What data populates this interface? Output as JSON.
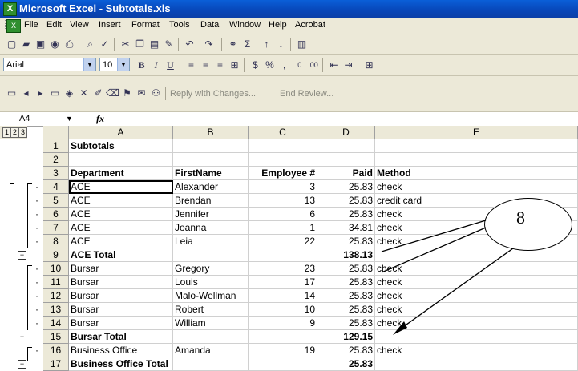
{
  "window": {
    "title": "Microsoft Excel - Subtotals.xls"
  },
  "menu": [
    "File",
    "Edit",
    "View",
    "Insert",
    "Format",
    "Tools",
    "Data",
    "Window",
    "Help",
    "Acrobat"
  ],
  "formatting": {
    "font": "Arial",
    "size": "10"
  },
  "reviewing": {
    "reply_text": "Reply with Changes...",
    "end_review": "End Review..."
  },
  "formula_bar": {
    "name_box": "A4",
    "fx": "fx"
  },
  "levels": [
    "1",
    "2",
    "3"
  ],
  "columns": [
    "A",
    "B",
    "C",
    "D",
    "E"
  ],
  "rows": [
    {
      "num": "1",
      "cells": [
        "Subtotals",
        "",
        "",
        "",
        ""
      ],
      "bold": true
    },
    {
      "num": "2",
      "cells": [
        "",
        "",
        "",
        "",
        ""
      ]
    },
    {
      "num": "3",
      "cells": [
        "Department",
        "FirstName",
        "Employee #",
        "Paid",
        "Method"
      ],
      "bold": true
    },
    {
      "num": "4",
      "cells": [
        "ACE",
        "Alexander",
        "3",
        "25.83",
        "check"
      ]
    },
    {
      "num": "5",
      "cells": [
        "ACE",
        "Brendan",
        "13",
        "25.83",
        "credit card"
      ]
    },
    {
      "num": "6",
      "cells": [
        "ACE",
        "Jennifer",
        "6",
        "25.83",
        "check"
      ]
    },
    {
      "num": "7",
      "cells": [
        "ACE",
        "Joanna",
        "1",
        "34.81",
        "check"
      ]
    },
    {
      "num": "8",
      "cells": [
        "ACE",
        "Leia",
        "22",
        "25.83",
        "check"
      ]
    },
    {
      "num": "9",
      "cells": [
        "ACE Total",
        "",
        "",
        "138.13",
        ""
      ],
      "bold": true
    },
    {
      "num": "10",
      "cells": [
        "Bursar",
        "Gregory",
        "23",
        "25.83",
        "check"
      ]
    },
    {
      "num": "11",
      "cells": [
        "Bursar",
        "Louis",
        "17",
        "25.83",
        "check"
      ]
    },
    {
      "num": "12",
      "cells": [
        "Bursar",
        "Malo-Wellman",
        "14",
        "25.83",
        "check"
      ]
    },
    {
      "num": "13",
      "cells": [
        "Bursar",
        "Robert",
        "10",
        "25.83",
        "check"
      ]
    },
    {
      "num": "14",
      "cells": [
        "Bursar",
        "William",
        "9",
        "25.83",
        "check"
      ]
    },
    {
      "num": "15",
      "cells": [
        "Bursar Total",
        "",
        "",
        "129.15",
        ""
      ],
      "bold": true
    },
    {
      "num": "16",
      "cells": [
        "Business Office",
        "Amanda",
        "19",
        "25.83",
        "check"
      ]
    },
    {
      "num": "17",
      "cells": [
        "Business Office Total",
        "",
        "",
        "25.83",
        ""
      ],
      "bold": true
    }
  ],
  "callout": {
    "label": "8"
  }
}
